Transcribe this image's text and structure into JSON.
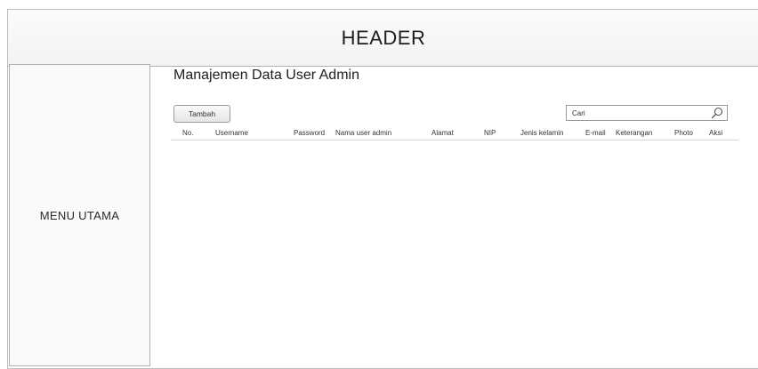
{
  "header": {
    "title": "HEADER"
  },
  "sidebar": {
    "label": "MENU UTAMA"
  },
  "main": {
    "title": "Manajemen Data User Admin",
    "add_button_label": "Tambah",
    "search": {
      "placeholder": "Cari"
    },
    "table": {
      "columns": [
        "No.",
        "Username",
        "Password",
        "Nama user admin",
        "Alamat",
        "NIP",
        "Jenis kelamin",
        "E-mail",
        "Keterangan",
        "Photo",
        "Aksi"
      ],
      "rows": []
    }
  }
}
